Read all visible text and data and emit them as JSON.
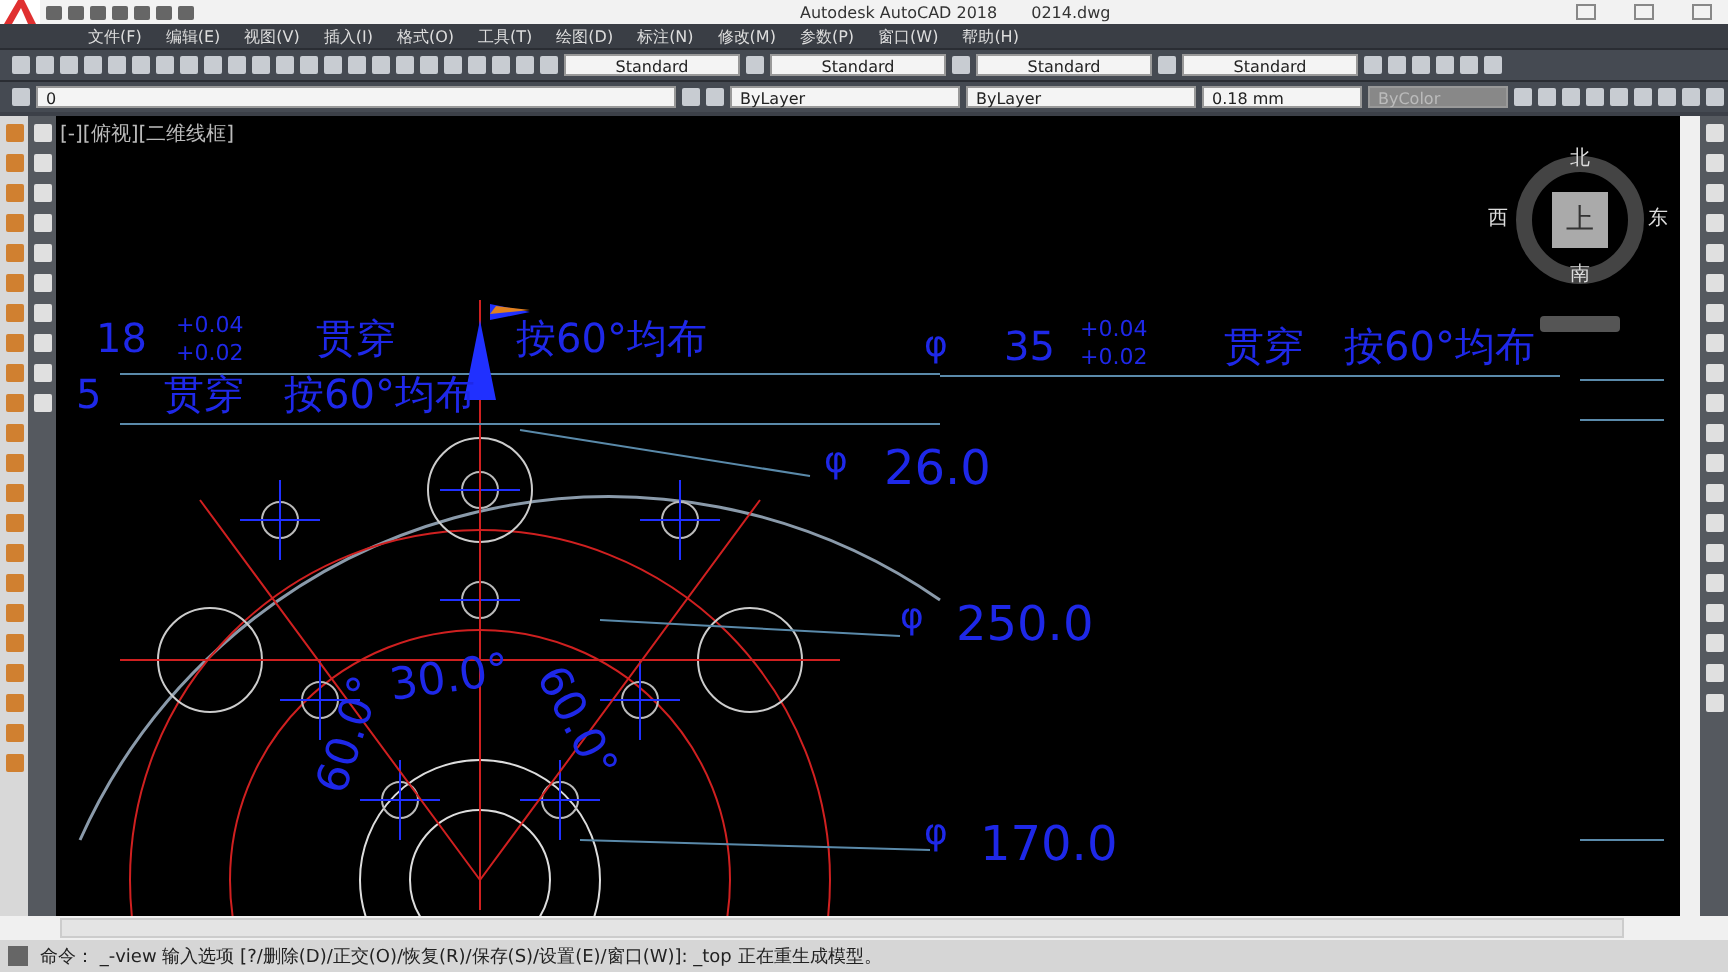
{
  "window": {
    "title": "Autodesk AutoCAD 2018",
    "file": "0214.dwg"
  },
  "menu": [
    "文件(F)",
    "编辑(E)",
    "视图(V)",
    "插入(I)",
    "格式(O)",
    "工具(T)",
    "绘图(D)",
    "标注(N)",
    "修改(M)",
    "参数(P)",
    "窗口(W)",
    "帮助(H)"
  ],
  "styles": [
    "Standard",
    "Standard",
    "Standard",
    "Standard"
  ],
  "properties": {
    "layer": "0",
    "object_color": "ByLayer",
    "linetype": "ByLayer",
    "lineweight": "0.18 mm",
    "plot_style": "ByColor"
  },
  "viewport": {
    "label": "[-][俯视][二维线框]"
  },
  "viewcube": {
    "north": "北",
    "east": "东",
    "south": "南",
    "west": "西",
    "face": "上"
  },
  "annotations": [
    {
      "text": "18"
    },
    {
      "text": "+0.04"
    },
    {
      "text": "+0.02"
    },
    {
      "text": "贯穿"
    },
    {
      "text": "按60°均布"
    },
    {
      "text": "5"
    },
    {
      "text": "贯穿"
    },
    {
      "text": "按60°均布"
    },
    {
      "text": "φ"
    },
    {
      "text": "35"
    },
    {
      "text": "+0.04"
    },
    {
      "text": "+0.02"
    },
    {
      "text": "贯穿"
    },
    {
      "text": "按60°均布"
    },
    {
      "text": "φ"
    },
    {
      "text": "26.0"
    },
    {
      "text": "φ"
    },
    {
      "text": "250.0"
    },
    {
      "text": "φ"
    },
    {
      "text": "170.0"
    },
    {
      "text": "60.0°"
    },
    {
      "text": "30.0°"
    },
    {
      "text": "60.0°"
    }
  ],
  "command_line": {
    "text": "命令： _-view 输入选项 [?/删除(D)/正交(O)/恢复(R)/保存(S)/设置(E)/窗口(W)]: _top 正在重生成模型。"
  }
}
